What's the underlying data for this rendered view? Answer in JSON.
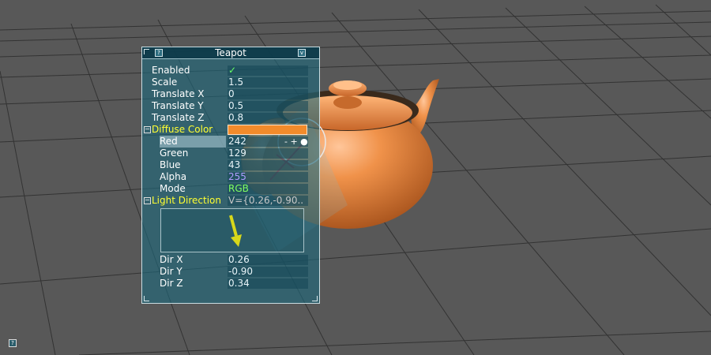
{
  "bar": {
    "title": "Teapot",
    "help_button": "?",
    "minimize_button": "v",
    "rows": {
      "enabled": {
        "label": "Enabled",
        "value": "✓"
      },
      "scale": {
        "label": "Scale",
        "value": "1.5"
      },
      "tx": {
        "label": "Translate X",
        "value": "0"
      },
      "ty": {
        "label": "Translate Y",
        "value": "0.5"
      },
      "tz": {
        "label": "Translate Z",
        "value": "0.8"
      },
      "diffuse": {
        "label": "Diffuse Color",
        "toggle": "−",
        "color": "#f28b2b"
      },
      "red": {
        "label": "Red",
        "value": "242",
        "inc_dec": "- + ●"
      },
      "green": {
        "label": "Green",
        "value": "129"
      },
      "blue": {
        "label": "Blue",
        "value": "43"
      },
      "alpha": {
        "label": "Alpha",
        "value": "255"
      },
      "mode": {
        "label": "Mode",
        "value": "RGB"
      },
      "light": {
        "label": "Light Direction",
        "toggle": "−",
        "value": "V={0.26,-0.90.."
      },
      "dirx": {
        "label": "Dir X",
        "value": "0.26"
      },
      "diry": {
        "label": "Dir Y",
        "value": "-0.90"
      },
      "dirz": {
        "label": "Dir Z",
        "value": "0.34"
      }
    }
  },
  "global_help_button": "?",
  "colors": {
    "background": "#585858",
    "teapot": "#e88a3e",
    "panel": "#1e697d",
    "group_label": "#ffff30",
    "arrow": "#d8d81a"
  }
}
